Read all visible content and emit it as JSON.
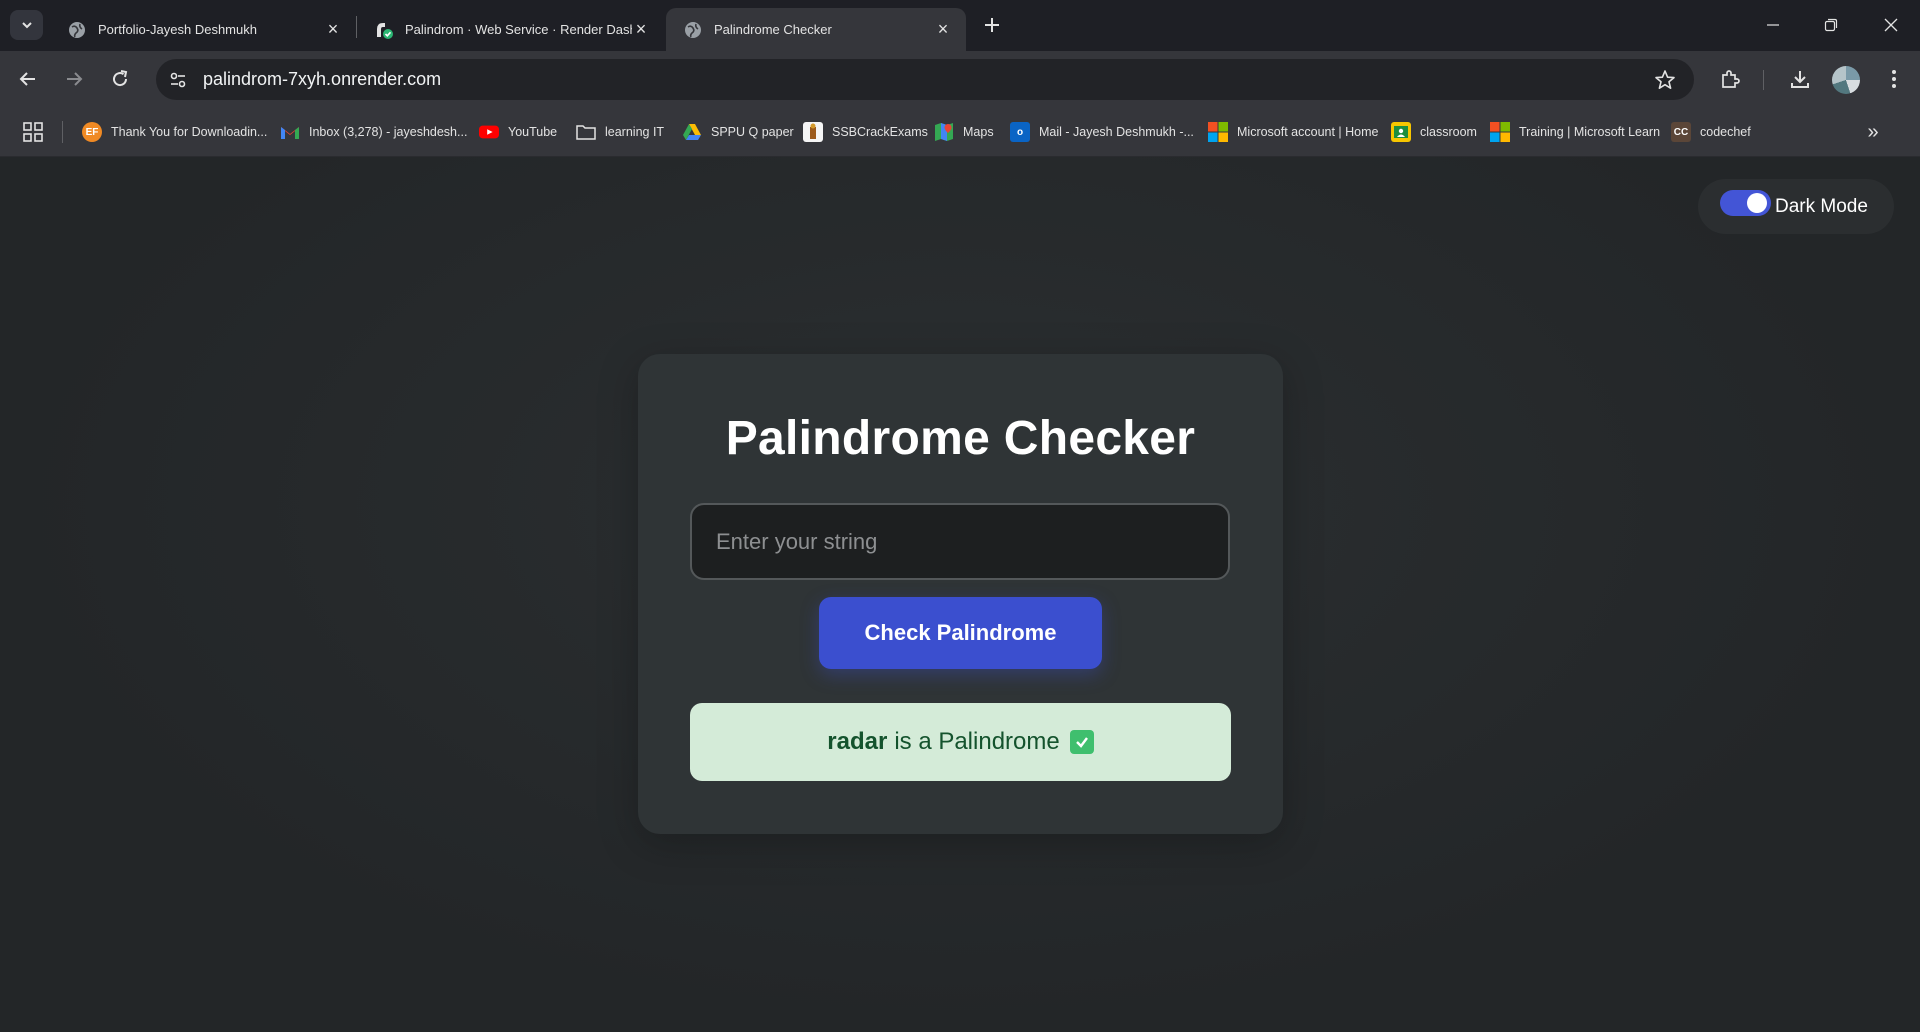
{
  "browser": {
    "tabs": [
      {
        "title": "Portfolio-Jayesh Deshmukh",
        "active": false,
        "icon": "globe-icon"
      },
      {
        "title": "Palindrom · Web Service · Render Dashbo",
        "active": false,
        "icon": "render-icon"
      },
      {
        "title": "Palindrome Checker",
        "active": true,
        "icon": "globe-icon"
      }
    ],
    "url": "palindrom-7xyh.onrender.com",
    "bookmarks": [
      {
        "label": "Thank You for Downloadin...",
        "icon": "ef-icon"
      },
      {
        "label": "Inbox (3,278) - jayeshdesh...",
        "icon": "gmail-icon"
      },
      {
        "label": "YouTube",
        "icon": "youtube-icon"
      },
      {
        "label": "learning IT",
        "icon": "folder-icon"
      },
      {
        "label": "SPPU Q paper",
        "icon": "drive-icon"
      },
      {
        "label": "SSBCrackExams",
        "icon": "ssb-icon"
      },
      {
        "label": "Maps",
        "icon": "maps-icon"
      },
      {
        "label": "Mail - Jayesh Deshmukh -...",
        "icon": "outlook-icon"
      },
      {
        "label": "Microsoft account | Home",
        "icon": "microsoft-icon"
      },
      {
        "label": "classroom",
        "icon": "classroom-icon"
      },
      {
        "label": "Training | Microsoft Learn",
        "icon": "microsoft-icon"
      },
      {
        "label": "codechef",
        "icon": "codechef-icon"
      }
    ]
  },
  "page": {
    "dark_mode_label": "Dark Mode",
    "dark_mode_on": true,
    "title": "Palindrome Checker",
    "input_placeholder": "Enter your string",
    "button_label": "Check Palindrome",
    "result": {
      "word": "radar",
      "text": "is a Palindrome"
    }
  },
  "colors": {
    "accent": "#3b4fcf",
    "result_bg": "#d4ebd8",
    "result_text": "#14532d"
  }
}
